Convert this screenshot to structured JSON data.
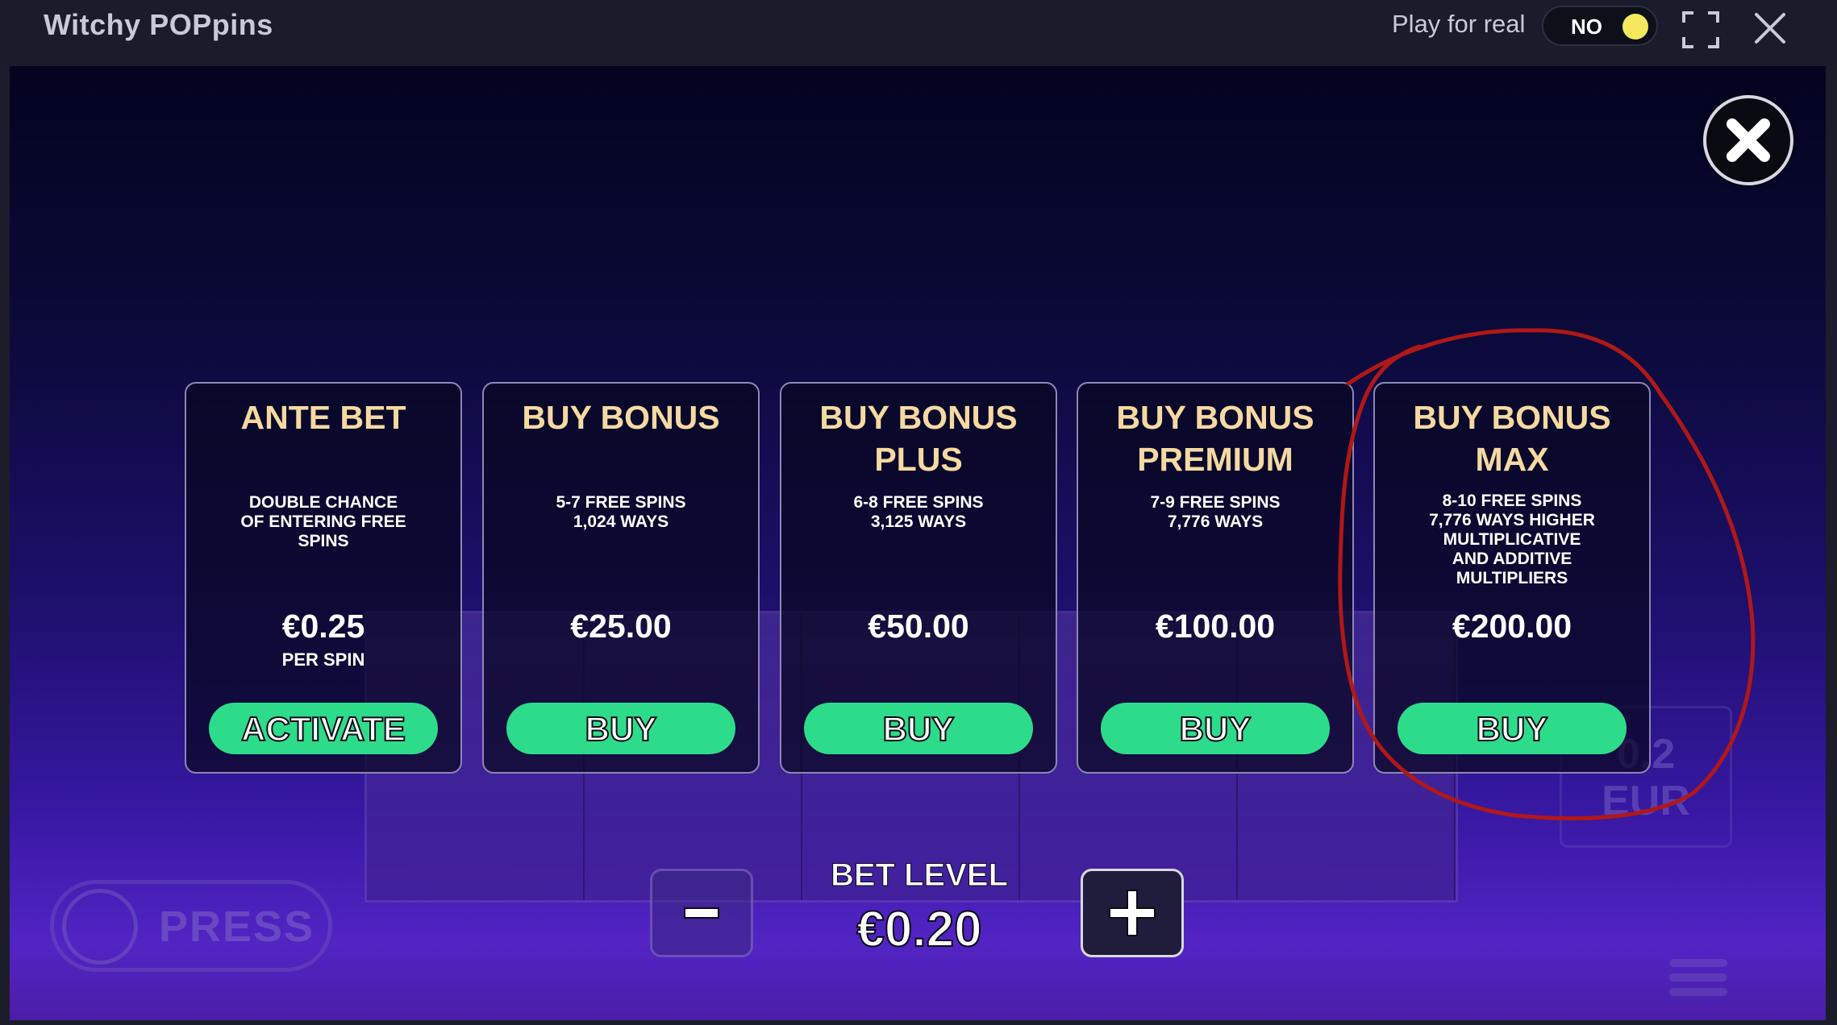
{
  "window": {
    "title": "Witchy POPpins",
    "play_for_real_label": "Play for real",
    "toggle_value": "NO",
    "toggle_knob_color": "#f5e85f"
  },
  "modal": {
    "cards": [
      {
        "title": "ANTE BET",
        "description": "DOUBLE CHANCE\nOF ENTERING FREE\nSPINS",
        "price": "€0.25",
        "price_note": "PER SPIN",
        "button": "ACTIVATE"
      },
      {
        "title": "BUY BONUS",
        "description": "5-7 FREE SPINS\n1,024 WAYS",
        "price": "€25.00",
        "price_note": "",
        "button": "BUY"
      },
      {
        "title": "BUY BONUS\nPLUS",
        "description": "6-8 FREE SPINS\n3,125 WAYS",
        "price": "€50.00",
        "price_note": "",
        "button": "BUY"
      },
      {
        "title": "BUY BONUS\nPREMIUM",
        "description": "7-9 FREE SPINS\n7,776 WAYS",
        "price": "€100.00",
        "price_note": "",
        "button": "BUY"
      },
      {
        "title": "BUY BONUS\nMAX",
        "description": "8-10 FREE SPINS\n7,776 WAYS HIGHER\nMULTIPLICATIVE\nAND ADDITIVE\nMULTIPLIERS",
        "price": "€200.00",
        "price_note": "",
        "button": "BUY"
      }
    ],
    "bet_level_label": "BET LEVEL",
    "bet_level_value": "€0.20"
  },
  "background": {
    "xpress_label": "PRESS",
    "balance_value": "0.2",
    "balance_currency": "EUR"
  },
  "colors": {
    "title_gold": "#f6d9a2",
    "button_green": "#2ddc8a",
    "annotation_red": "#b01818"
  }
}
